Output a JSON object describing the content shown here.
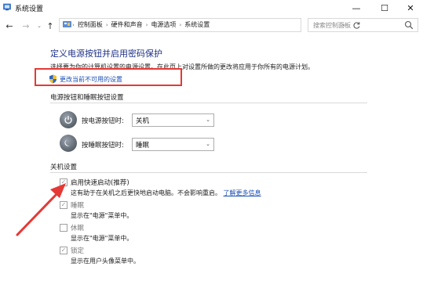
{
  "window": {
    "title": "系统设置",
    "min_glyph": "—",
    "max_glyph": "☐",
    "close_glyph": "✕"
  },
  "nav": {
    "back_glyph": "←",
    "forward_glyph": "→",
    "recent_glyph": "⌄",
    "up_glyph": "↑"
  },
  "breadcrumb": {
    "items": [
      "控制面板",
      "硬件和声音",
      "电源选项",
      "系统设置"
    ],
    "separator": "›"
  },
  "search": {
    "placeholder": "搜索控制面板"
  },
  "main": {
    "heading": "定义电源按钮并启用密码保护",
    "description": "选择要为你的计算机设置的电源设置。在此页上对设置所做的更改将应用于你所有的电源计划。",
    "change_link": "更改当前不可用的设置"
  },
  "power_buttons": {
    "group_title": "电源按钮和睡眠按钮设置",
    "rows": [
      {
        "label": "按电源按钮时:",
        "value": "关机",
        "icon": "power-icon"
      },
      {
        "label": "按睡眠按钮时:",
        "value": "睡眠",
        "icon": "sleep-icon"
      }
    ]
  },
  "shutdown": {
    "group_title": "关机设置",
    "items": [
      {
        "label": "启用快速启动(推荐)",
        "checked": true,
        "disabled": true,
        "description": "这有助于在关机之后更快地启动电脑。不会影响重启。",
        "link": "了解更多信息"
      },
      {
        "label": "睡眠",
        "checked": true,
        "disabled": true,
        "description": "显示在\"电源\"菜单中。"
      },
      {
        "label": "休眠",
        "checked": false,
        "disabled": true,
        "description": "显示在\"电源\"菜单中。"
      },
      {
        "label": "锁定",
        "checked": true,
        "disabled": true,
        "description": "显示在用户头像菜单中。"
      }
    ]
  },
  "colors": {
    "heading": "#1e3287",
    "link": "#1a4fb5",
    "annotation": "#e53935"
  }
}
